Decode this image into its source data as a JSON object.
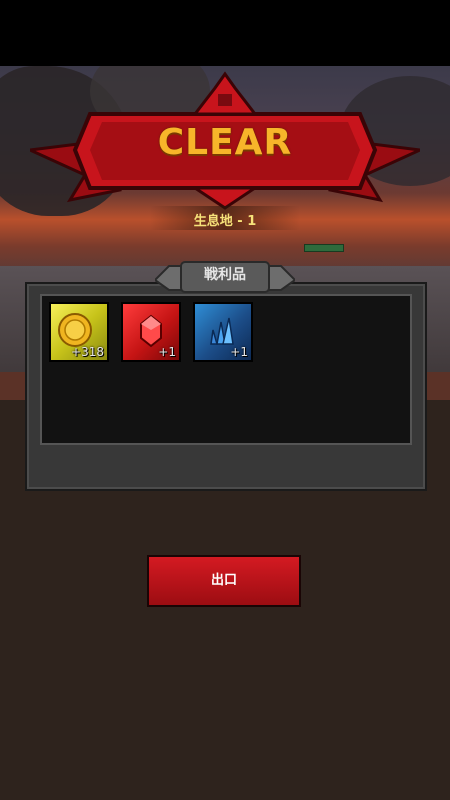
{
  "result": {
    "title": "CLEAR",
    "stage": "生息地 - 1"
  },
  "loot": {
    "tab_label": "戦利品",
    "items": [
      {
        "name": "gold-coin",
        "icon": "coin-icon",
        "count": "+318",
        "color": "#e8e23a"
      },
      {
        "name": "red-gem",
        "icon": "ruby-icon",
        "count": "+1",
        "color": "#e01a1a"
      },
      {
        "name": "blue-crystal",
        "icon": "crystal-icon",
        "count": "+1",
        "color": "#2a6fb8"
      }
    ]
  },
  "actions": {
    "exit_label": "出口"
  },
  "colors": {
    "banner": "#c8141c",
    "title": "#f7b52a",
    "stage_text": "#f6e27a",
    "button": "#c0141a"
  }
}
